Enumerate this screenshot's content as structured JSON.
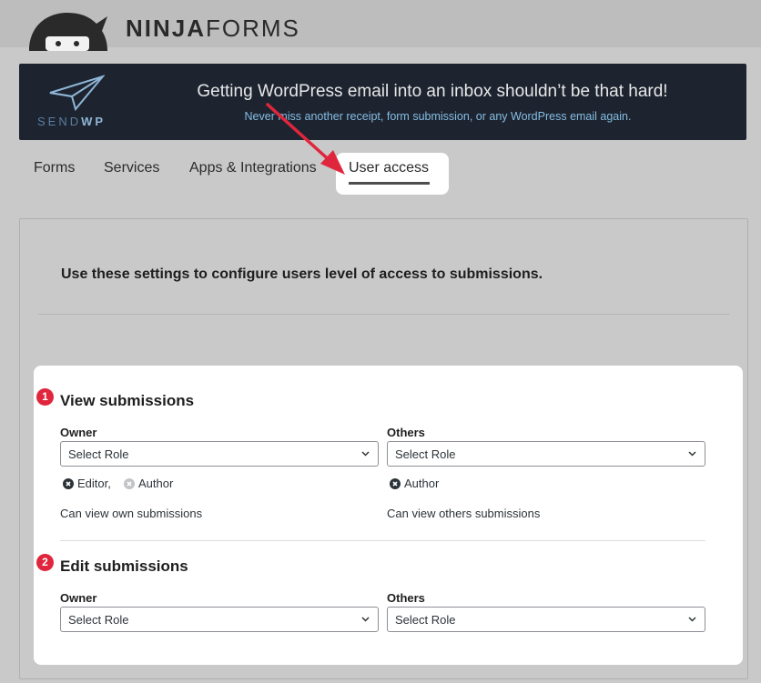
{
  "brand": {
    "ninja": "NINJA",
    "forms": "FORMS"
  },
  "banner": {
    "logo_send": "SEND",
    "logo_wp": "WP",
    "title": "Getting WordPress email into an inbox shouldn’t be that hard!",
    "subtitle": "Never miss another receipt, form submission, or any WordPress email again."
  },
  "tabs": [
    {
      "label": "Forms"
    },
    {
      "label": "Services"
    },
    {
      "label": "Apps & Integrations"
    },
    {
      "label": "User access",
      "active": true
    }
  ],
  "intro": "Use these settings to configure users level of access to submissions.",
  "sections": [
    {
      "badge": "1",
      "title": "View submissions",
      "owner": {
        "label": "Owner",
        "select": "Select Role",
        "tags": [
          "Editor,",
          "Author"
        ],
        "description": "Can view own submissions"
      },
      "others": {
        "label": "Others",
        "select": "Select Role",
        "tags": [
          "Author"
        ],
        "description": "Can view others submissions"
      }
    },
    {
      "badge": "2",
      "title": "Edit submissions",
      "owner": {
        "label": "Owner",
        "select": "Select Role"
      },
      "others": {
        "label": "Others",
        "select": "Select Role"
      }
    }
  ],
  "colors": {
    "banner_bg": "#1d2430",
    "badge": "#e0263d",
    "arrow": "#e0263d",
    "subtitle": "#86bde3"
  }
}
